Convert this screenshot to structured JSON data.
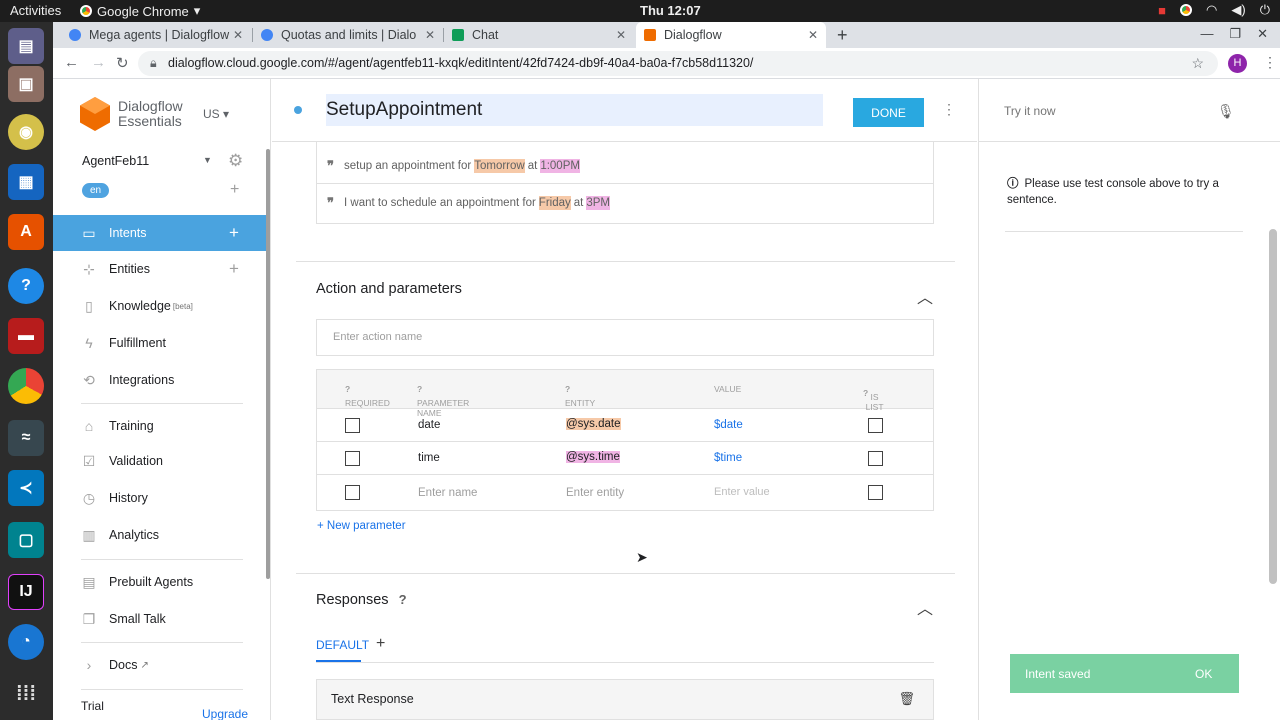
{
  "os": {
    "activities": "Activities",
    "app_name": "Google Chrome",
    "clock": "Thu 12:07"
  },
  "browser": {
    "tabs": [
      {
        "label": "Mega agents | Dialogflow",
        "fav_color": "#4285f4"
      },
      {
        "label": "Quotas and limits | Dialo",
        "fav_color": "#4285f4"
      },
      {
        "label": "Chat",
        "fav_color": "#0f9d58"
      },
      {
        "label": "Dialogflow",
        "fav_color": "#ef6c00"
      }
    ],
    "url": "dialogflow.cloud.google.com/#/agent/agentfeb11-kxqk/editIntent/42fd7424-db9f-40a4-ba0a-f7cb58d11320/",
    "profile_initial": "H"
  },
  "sidebar": {
    "brand_line1": "Dialogflow",
    "brand_line2": "Essentials",
    "region": "US",
    "agent_name": "AgentFeb11",
    "language": "en",
    "items": [
      {
        "label": "Intents"
      },
      {
        "label": "Entities"
      },
      {
        "label": "Knowledge",
        "badge": "[beta]"
      },
      {
        "label": "Fulfillment"
      },
      {
        "label": "Integrations"
      },
      {
        "label": "Training"
      },
      {
        "label": "Validation"
      },
      {
        "label": "History"
      },
      {
        "label": "Analytics"
      },
      {
        "label": "Prebuilt Agents"
      },
      {
        "label": "Small Talk"
      },
      {
        "label": "Docs"
      }
    ],
    "trial": "Trial",
    "upgrade": "Upgrade"
  },
  "intent": {
    "name": "SetupAppointment",
    "done_label": "DONE",
    "phrases": [
      {
        "pre": "setup an appointment for",
        "p1": "Tomorrow",
        "mid": "at",
        "p2": "1:00PM"
      },
      {
        "pre": "I want to schedule an appointment for",
        "p1": "Friday",
        "mid": "at",
        "p2": "3PM"
      }
    ]
  },
  "actions": {
    "title": "Action and parameters",
    "action_placeholder": "Enter action name",
    "headers": {
      "required": "REQUIRED",
      "param": "PARAMETER NAME",
      "entity": "ENTITY",
      "value": "VALUE",
      "islist": "IS LIST"
    },
    "rows": [
      {
        "name": "date",
        "entity": "@sys.date",
        "value": "$date"
      },
      {
        "name": "time",
        "entity": "@sys.time",
        "value": "$time"
      }
    ],
    "new_row": {
      "name": "Enter name",
      "entity": "Enter entity",
      "value": "Enter value"
    },
    "new_param": "New parameter"
  },
  "responses": {
    "title": "Responses",
    "tab": "DEFAULT",
    "text_response": "Text Response"
  },
  "console": {
    "try_it": "Try it now",
    "info": "Please use test console above to try a sentence.",
    "toast": "Intent saved",
    "toast_ok": "OK"
  }
}
